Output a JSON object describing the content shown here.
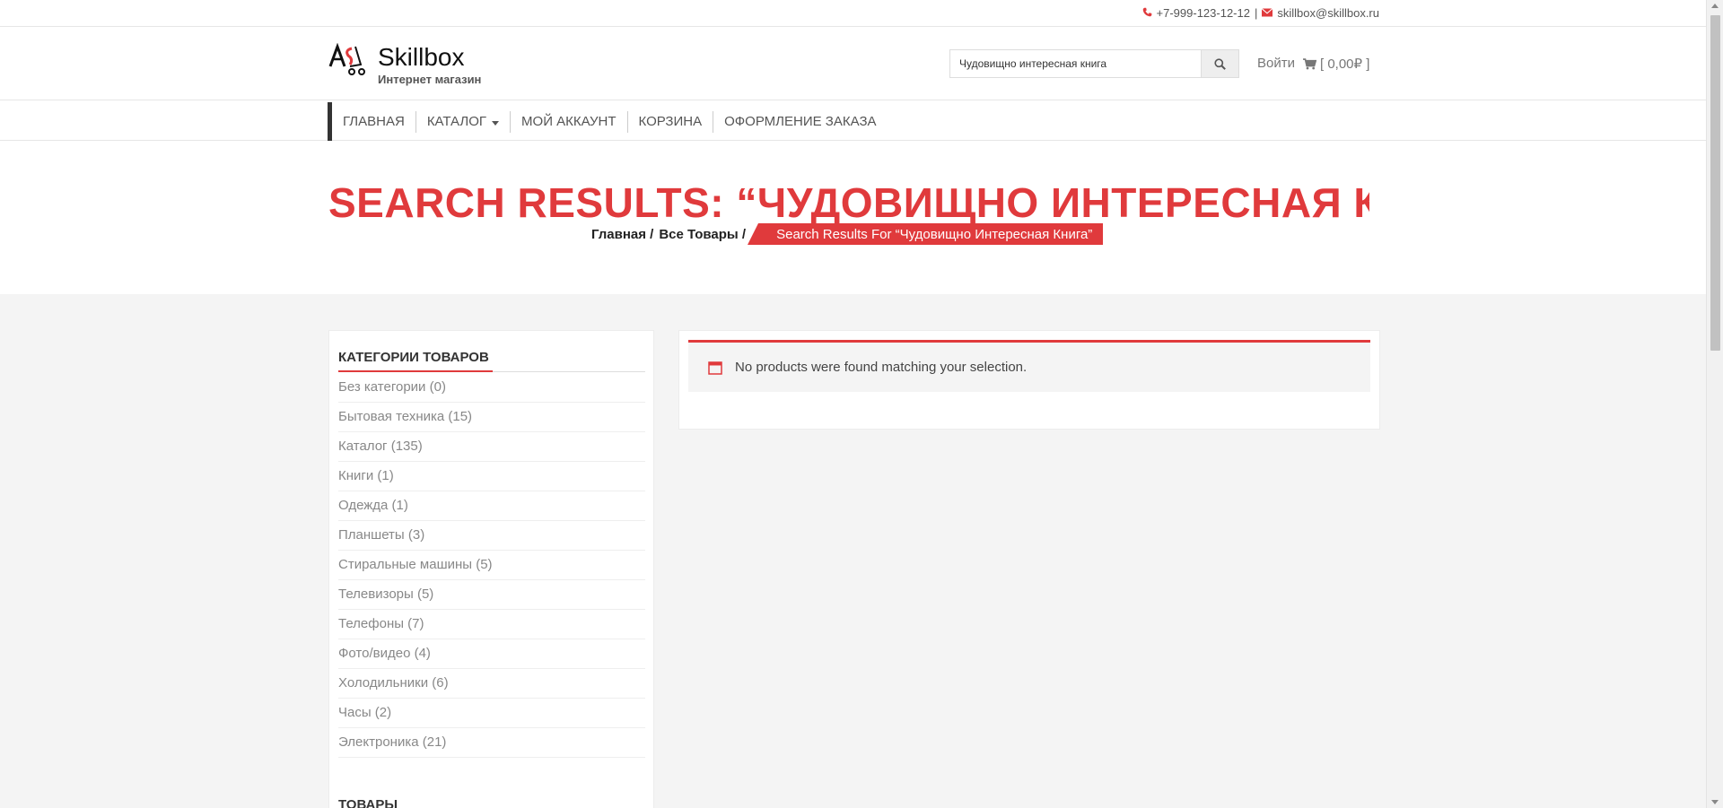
{
  "topbar": {
    "phone": "+7-999-123-12-12",
    "separator": "|",
    "email": "skillbox@skillbox.ru"
  },
  "header": {
    "brand": "Skillbox",
    "subtitle": "Интернет магазин",
    "search_value": "Чудовищно интересная книга",
    "login": "Войти",
    "cart": "[ 0,00₽ ]"
  },
  "nav": {
    "items": [
      "ГЛАВНАЯ",
      "КАТАЛОГ",
      "МОЙ АККАУНТ",
      "КОРЗИНА",
      "ОФОРМЛЕНИЕ ЗАКАЗА"
    ]
  },
  "hero": {
    "title": "SEARCH RESULTS: “ЧУДОВИЩНО ИНТЕРЕСНАЯ КНИ...",
    "crumbs": [
      "Главная /",
      "Все Товары /"
    ],
    "active_crumb": "Search Results For “Чудовищно Интересная Книга”"
  },
  "sidebar": {
    "heading": "КАТЕГОРИИ ТОВАРОВ",
    "categories": [
      "Без категории (0)",
      "Бытовая техника (15)",
      "Каталог (135)",
      "Книги (1)",
      "Одежда (1)",
      "Планшеты (3)",
      "Стиральные машины (5)",
      "Телевизоры (5)",
      "Телефоны (7)",
      "Фото/видео (4)",
      "Холодильники (6)",
      "Часы (2)",
      "Электроника (21)"
    ],
    "heading2": "ТОВАРЫ"
  },
  "main": {
    "notice": "No products were found matching your selection."
  },
  "colors": {
    "accent": "#e03a3c",
    "content_bg": "#f4f4f4"
  }
}
